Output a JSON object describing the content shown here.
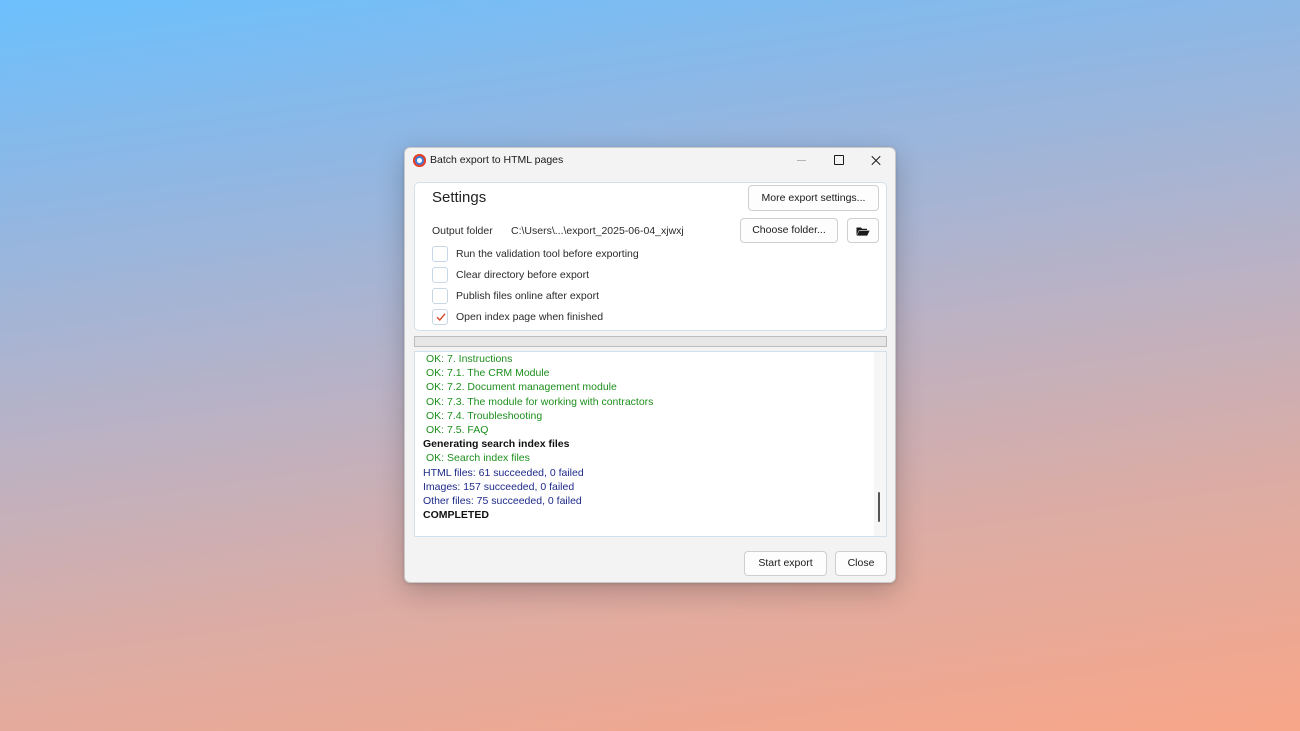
{
  "window": {
    "title": "Batch export to HTML pages",
    "minimize_glyph": "—",
    "maximize_glyph": "▢",
    "close_glyph": "✕"
  },
  "settings": {
    "title": "Settings",
    "more_button": "More export settings...",
    "output_folder_label": "Output folder",
    "output_folder_path": "C:\\Users\\...\\export_2025-06-04_xjwxj",
    "choose_folder_button": "Choose folder...",
    "open_folder_icon": "open-folder-icon",
    "options": [
      {
        "label": "Run the validation tool before exporting",
        "checked": false
      },
      {
        "label": "Clear directory before export",
        "checked": false
      },
      {
        "label": "Publish files online after export",
        "checked": false
      },
      {
        "label": "Open index page when finished",
        "checked": true
      }
    ]
  },
  "progress": {
    "value": 0
  },
  "log": {
    "lines": [
      {
        "text": "OK: 7. Instructions",
        "kind": "ok"
      },
      {
        "text": "OK: 7.1. The CRM Module",
        "kind": "ok"
      },
      {
        "text": "OK: 7.2. Document management module",
        "kind": "ok"
      },
      {
        "text": "OK: 7.3. The module for working with contractors",
        "kind": "ok"
      },
      {
        "text": "OK: 7.4. Troubleshooting",
        "kind": "ok"
      },
      {
        "text": "OK: 7.5. FAQ",
        "kind": "ok"
      },
      {
        "text": "Generating search index files",
        "kind": "bold"
      },
      {
        "text": "OK: Search index files",
        "kind": "ok"
      },
      {
        "text": "HTML files:  61 succeeded, 0 failed",
        "kind": "stat"
      },
      {
        "text": "Images:  157 succeeded, 0 failed",
        "kind": "stat"
      },
      {
        "text": "Other files:  75 succeeded, 0 failed",
        "kind": "stat"
      },
      {
        "text": "COMPLETED",
        "kind": "bold"
      }
    ]
  },
  "footer": {
    "start_button": "Start export",
    "close_button": "Close"
  },
  "colors": {
    "ok": "#1d8f1d",
    "stat": "#1e2a8a",
    "check_accent": "#d9472b"
  }
}
